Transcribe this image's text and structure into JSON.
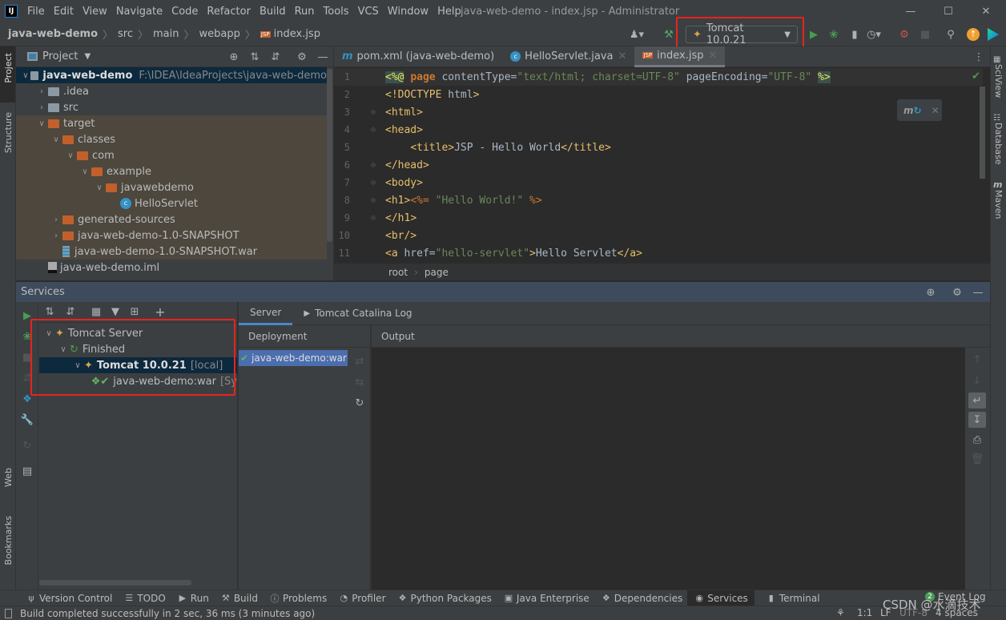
{
  "window": {
    "title": "java-web-demo - index.jsp - Administrator",
    "logo": "IJ"
  },
  "menu": [
    "File",
    "Edit",
    "View",
    "Navigate",
    "Code",
    "Refactor",
    "Build",
    "Run",
    "Tools",
    "VCS",
    "Window",
    "Help"
  ],
  "breadcrumb": [
    "java-web-demo",
    "src",
    "main",
    "webapp",
    "index.jsp"
  ],
  "toolbar": {
    "run_config": "Tomcat 10.0.21"
  },
  "left_stripe": [
    "Project",
    "Structure",
    "Web",
    "Bookmarks"
  ],
  "right_stripe": [
    "SciView",
    "Database",
    "Maven"
  ],
  "project": {
    "title": "Project",
    "tree": [
      {
        "label": "java-web-demo",
        "path": "F:\\IDEA\\IdeaProjects\\java-web-demo",
        "depth": 0,
        "open": true,
        "kind": "module"
      },
      {
        "label": ".idea",
        "depth": 1,
        "open": false,
        "kind": "folder-grey"
      },
      {
        "label": "src",
        "depth": 1,
        "open": false,
        "kind": "folder-grey"
      },
      {
        "label": "target",
        "depth": 1,
        "open": true,
        "kind": "folder"
      },
      {
        "label": "classes",
        "depth": 2,
        "open": true,
        "kind": "folder"
      },
      {
        "label": "com",
        "depth": 3,
        "open": true,
        "kind": "folder"
      },
      {
        "label": "example",
        "depth": 4,
        "open": true,
        "kind": "folder"
      },
      {
        "label": "javawebdemo",
        "depth": 5,
        "open": true,
        "kind": "folder"
      },
      {
        "label": "HelloServlet",
        "depth": 6,
        "kind": "class"
      },
      {
        "label": "generated-sources",
        "depth": 2,
        "open": false,
        "kind": "folder"
      },
      {
        "label": "java-web-demo-1.0-SNAPSHOT",
        "depth": 2,
        "open": false,
        "kind": "folder"
      },
      {
        "label": "java-web-demo-1.0-SNAPSHOT.war",
        "depth": 2,
        "kind": "war"
      },
      {
        "label": "java-web-demo.iml",
        "depth": 1,
        "kind": "iml"
      }
    ]
  },
  "editor": {
    "tabs": [
      {
        "label": "pom.xml (java-web-demo)",
        "icon": "maven-icon"
      },
      {
        "label": "HelloServlet.java",
        "icon": "class-icon"
      },
      {
        "label": "index.jsp",
        "icon": "jsp-icon",
        "active": true
      }
    ],
    "breadcrumb": [
      "root",
      "page"
    ]
  },
  "code": {
    "lines": [
      "<%@ page contentType=\"text/html; charset=UTF-8\" pageEncoding=\"UTF-8\" %>",
      "<!DOCTYPE html>",
      "<html>",
      "<head>",
      "    <title>JSP - Hello World</title>",
      "</head>",
      "<body>",
      "<h1><%= \"Hello World!\" %>",
      "</h1>",
      "<br/>",
      "<a href=\"hello-servlet\">Hello Servlet</a>"
    ],
    "colors": {
      "tag": "#e8bf6a",
      "string": "#6a8759",
      "attr": "#bababa",
      "keyword": "#cc7832"
    }
  },
  "services": {
    "title": "Services",
    "tree": [
      {
        "label": "Tomcat Server",
        "depth": 0
      },
      {
        "label": "Finished",
        "depth": 1
      },
      {
        "label": "Tomcat 10.0.21",
        "suffix": "[local]",
        "depth": 2,
        "selected": true
      },
      {
        "label": "java-web-demo:war",
        "suffix": "[Sy",
        "depth": 3
      }
    ],
    "tabs": [
      "Server",
      "Tomcat Catalina Log"
    ],
    "deployment_header": "Deployment",
    "output_header": "Output",
    "deployment_item": "java-web-demo:war"
  },
  "bottom_tools": [
    "Version Control",
    "TODO",
    "Run",
    "Build",
    "Problems",
    "Profiler",
    "Python Packages",
    "Java Enterprise",
    "Dependencies",
    "Services",
    "Terminal"
  ],
  "event_log": {
    "label": "Event Log",
    "count": "2"
  },
  "status": {
    "message": "Build completed successfully in 2 sec, 36 ms (3 minutes ago)",
    "position": "1:1",
    "line_sep": "LF",
    "encoding": "UTF-8",
    "indent": "4 spaces"
  },
  "watermark": "CSDN @水滴技术"
}
